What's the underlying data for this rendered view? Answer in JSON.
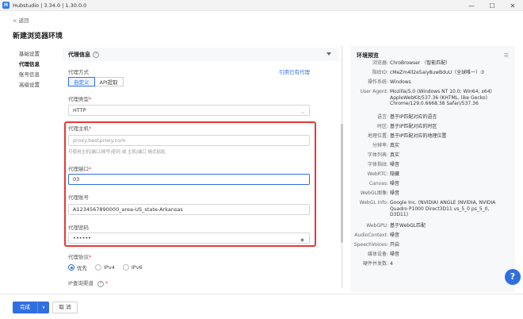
{
  "window": {
    "logo_text": "H",
    "title": "Hubstudio | 3.34.0 | 1.30.0.0",
    "minimize": "—",
    "maximize": "☐",
    "close": "✕"
  },
  "back": "< 返回",
  "page_title": "新建浏览器环境",
  "sidenav": [
    "基础设置",
    "代理信息",
    "账号信息",
    "高级设置"
  ],
  "proxy": {
    "section_title": "代理信息",
    "help": "?",
    "proxy_method_label": "代理方式",
    "use_existing_link": "引用已有代理",
    "method_options": [
      "自定义",
      "API提取"
    ],
    "type_label": "代理类型",
    "type_value": "HTTP",
    "host_label": "代理主机",
    "host_placeholder": "proxy.bestproxy.com",
    "host_hint": "可使用主机|端口|账号|密码 或 主机|端口 格式粘贴",
    "port_label": "代理端口",
    "port_value": "03",
    "account_label": "代理账号",
    "account_value": "A1234567890000_area-US_state-Arkansas",
    "password_label": "代理密码",
    "password_value": "••••••",
    "eye": "◉",
    "protocol_label": "代理协议",
    "protocol_options": [
      "优先",
      "IPv4",
      "IPv6"
    ],
    "ip_channel_label": "IP查询渠道",
    "required_mark": "*",
    "chevron": "⌵"
  },
  "preview": {
    "title": "环境预览",
    "list_icon": "☰",
    "rows": [
      {
        "k": "浏览器:",
        "v": "ChroBrowser （智能匹配）"
      },
      {
        "k": "指纹ID:",
        "v": "cMeZm4ll2e5aiy8uwBduU（全球唯一）⑦"
      },
      {
        "k": "操作系统:",
        "v": "Windows"
      },
      {
        "k": "User Agent:",
        "v": "Mozilla/5.0 (Windows NT 10.0; Win64; x64) AppleWebKit/537.36 (KHTML, like Gecko) Chrome/129.0.6668.38 Safari/537.36"
      },
      {
        "k": "语言:",
        "v": "基于IP匹配对应的语言"
      },
      {
        "k": "时区:",
        "v": "基于IP匹配对应的时区"
      },
      {
        "k": "地理位置:",
        "v": "基于IP匹配对应的地理位置"
      },
      {
        "k": "分辨率:",
        "v": "真实"
      },
      {
        "k": "字体列表:",
        "v": "真实"
      },
      {
        "k": "字体指纹:",
        "v": "噪音"
      },
      {
        "k": "WebRTC:",
        "v": "隐藏"
      },
      {
        "k": "Canvas:",
        "v": "噪音"
      },
      {
        "k": "WebGL图像:",
        "v": "噪音"
      },
      {
        "k": "WebGL Info:",
        "v": "Google Inc. (NVIDIA) ANGLE (NVIDIA, NVIDIA Quadro P1000 Direct3D11 vs_5_0 ps_5_0, D3D11)"
      },
      {
        "k": "WebGPU:",
        "v": "基于WebGL匹配"
      },
      {
        "k": "AudioContext:",
        "v": "噪音"
      },
      {
        "k": "SpeechVoices:",
        "v": "开启"
      },
      {
        "k": "媒体设备:",
        "v": "噪音"
      },
      {
        "k": "硬件并发数:",
        "v": "4"
      }
    ]
  },
  "footer": {
    "done": "完成",
    "done_drop": "∨",
    "cancel": "取 消"
  },
  "help_fab": "?"
}
